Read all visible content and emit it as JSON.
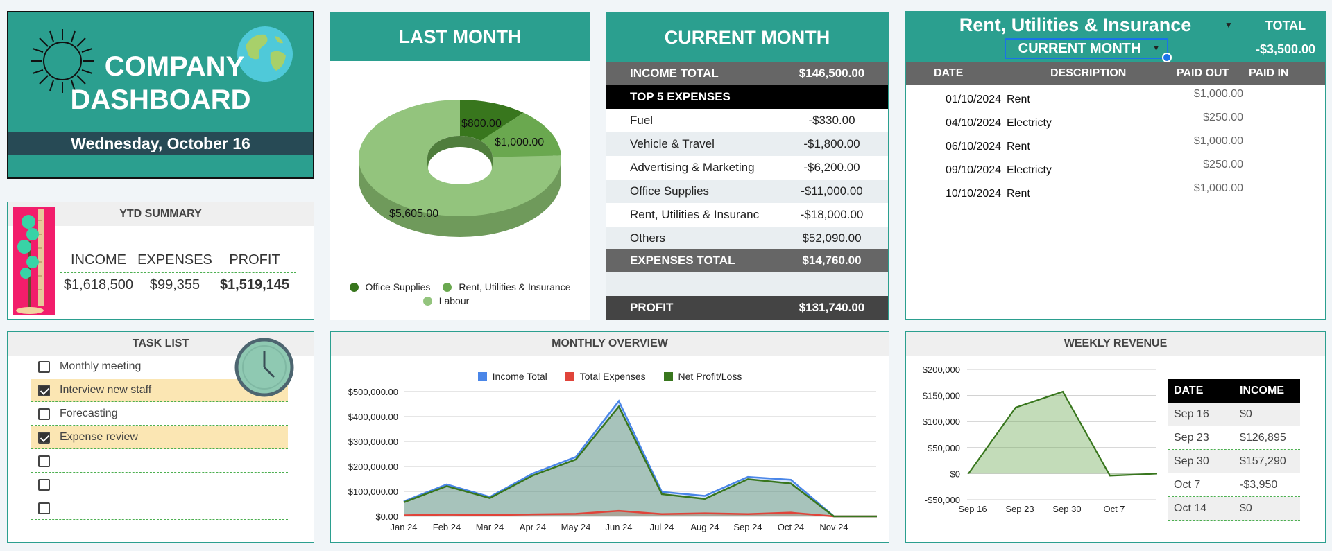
{
  "title_card": {
    "title_line1": "COMPANY",
    "title_line2": "DASHBOARD",
    "date": "Wednesday, October 16"
  },
  "ytd": {
    "header": "YTD SUMMARY",
    "labels": [
      "INCOME",
      "EXPENSES",
      "PROFIT"
    ],
    "values": [
      "$1,618,500",
      "$99,355",
      "$1,519,145"
    ]
  },
  "last_month": {
    "header": "LAST MONTH",
    "slice_labels": [
      "$800.00",
      "$1,000.00",
      "$5,605.00"
    ],
    "legend": [
      "Office Supplies",
      "Rent, Utilities & Insurance",
      "Labour"
    ],
    "colors": [
      "#38761d",
      "#6aa84f",
      "#93c47d"
    ]
  },
  "current_month": {
    "header": "CURRENT MONTH",
    "income_label": "INCOME TOTAL",
    "income_value": "$146,500.00",
    "top5_label": "TOP 5 EXPENSES",
    "expenses": [
      {
        "label": "Fuel",
        "value": "-$330.00"
      },
      {
        "label": "Vehicle & Travel",
        "value": "-$1,800.00"
      },
      {
        "label": "Advertising & Marketing",
        "value": "-$6,200.00"
      },
      {
        "label": "Office Supplies",
        "value": "-$11,000.00"
      },
      {
        "label": "Rent, Utilities & Insuranc",
        "value": "-$18,000.00"
      },
      {
        "label": "Others",
        "value": "$52,090.00"
      }
    ],
    "expenses_total_label": "EXPENSES TOTAL",
    "expenses_total_value": "$14,760.00",
    "profit_label": "PROFIT",
    "profit_value": "$131,740.00"
  },
  "rent_panel": {
    "title": "Rent, Utilities & Insurance",
    "period_select": "CURRENT MONTH",
    "total_label": "TOTAL",
    "total_value": "-$3,500.00",
    "columns": [
      "DATE",
      "DESCRIPTION",
      "PAID OUT",
      "PAID IN"
    ],
    "rows": [
      {
        "date": "01/10/2024",
        "desc": "Rent",
        "out": "$1,000.00"
      },
      {
        "date": "04/10/2024",
        "desc": "Electricty",
        "out": "$250.00"
      },
      {
        "date": "06/10/2024",
        "desc": "Rent",
        "out": "$1,000.00"
      },
      {
        "date": "09/10/2024",
        "desc": "Electricty",
        "out": "$250.00"
      },
      {
        "date": "10/10/2024",
        "desc": "Rent",
        "out": "$1,000.00"
      }
    ]
  },
  "tasks": {
    "header": "TASK LIST",
    "items": [
      {
        "label": "Monthly meeting",
        "done": false
      },
      {
        "label": "Interview new staff",
        "done": true
      },
      {
        "label": "Forecasting",
        "done": false
      },
      {
        "label": "Expense review",
        "done": true
      },
      {
        "label": "",
        "done": false
      },
      {
        "label": "",
        "done": false
      },
      {
        "label": "",
        "done": false
      }
    ]
  },
  "monthly_overview": {
    "header": "MONTHLY OVERVIEW"
  },
  "weekly_revenue": {
    "header": "WEEKLY REVENUE",
    "table_headers": [
      "DATE",
      "INCOME"
    ],
    "table_rows": [
      {
        "date": "Sep 16",
        "income": "$0"
      },
      {
        "date": "Sep 23",
        "income": "$126,895"
      },
      {
        "date": "Sep 30",
        "income": "$157,290"
      },
      {
        "date": "Oct 7",
        "income": "-$3,950"
      },
      {
        "date": "Oct 14",
        "income": "$0"
      }
    ]
  },
  "chart_data": [
    {
      "type": "pie",
      "categories": [
        "Office Supplies",
        "Rent, Utilities & Insurance",
        "Labour"
      ],
      "values": [
        800,
        1000,
        5605
      ],
      "data_labels": [
        "$800.00",
        "$1,000.00",
        "$5,605.00"
      ],
      "legend_position": "bottom"
    },
    {
      "type": "area",
      "title": "",
      "categories": [
        "Jan 24",
        "Feb 24",
        "Mar 24",
        "Apr 24",
        "May 24",
        "Jun 24",
        "Jul 24",
        "Aug 24",
        "Sep 24",
        "Oct 24",
        "Nov 24"
      ],
      "series": [
        {
          "name": "Income Total",
          "color": "#4a86e8",
          "values": [
            60000,
            128000,
            78000,
            172000,
            238000,
            462000,
            98000,
            82000,
            158000,
            146500,
            0
          ]
        },
        {
          "name": "Total Expenses",
          "color": "#e0443a",
          "values": [
            4000,
            7000,
            5000,
            8000,
            10000,
            22000,
            9000,
            12000,
            9000,
            14760,
            0
          ]
        },
        {
          "name": "Net Profit/Loss",
          "color": "#38761d",
          "values": [
            56000,
            121000,
            73000,
            164000,
            228000,
            440000,
            89000,
            70000,
            149000,
            131740,
            0
          ]
        }
      ],
      "ylim": [
        0,
        500000
      ],
      "yticks": [
        "$0.00",
        "$100,000.00",
        "$200,000.00",
        "$300,000.00",
        "$400,000.00",
        "$500,000.00"
      ],
      "grid": true,
      "legend_position": "top"
    },
    {
      "type": "area",
      "categories": [
        "Sep 16",
        "Sep 23",
        "Sep 30",
        "Oct 7",
        "Oct 14"
      ],
      "series": [
        {
          "name": "Income",
          "color": "#38761d",
          "values": [
            0,
            126895,
            157290,
            -3950,
            0
          ]
        }
      ],
      "ylim": [
        -50000,
        200000
      ],
      "yticks": [
        "-$50,000",
        "$0",
        "$50,000",
        "$100,000",
        "$150,000",
        "$200,000"
      ],
      "grid": true
    }
  ]
}
